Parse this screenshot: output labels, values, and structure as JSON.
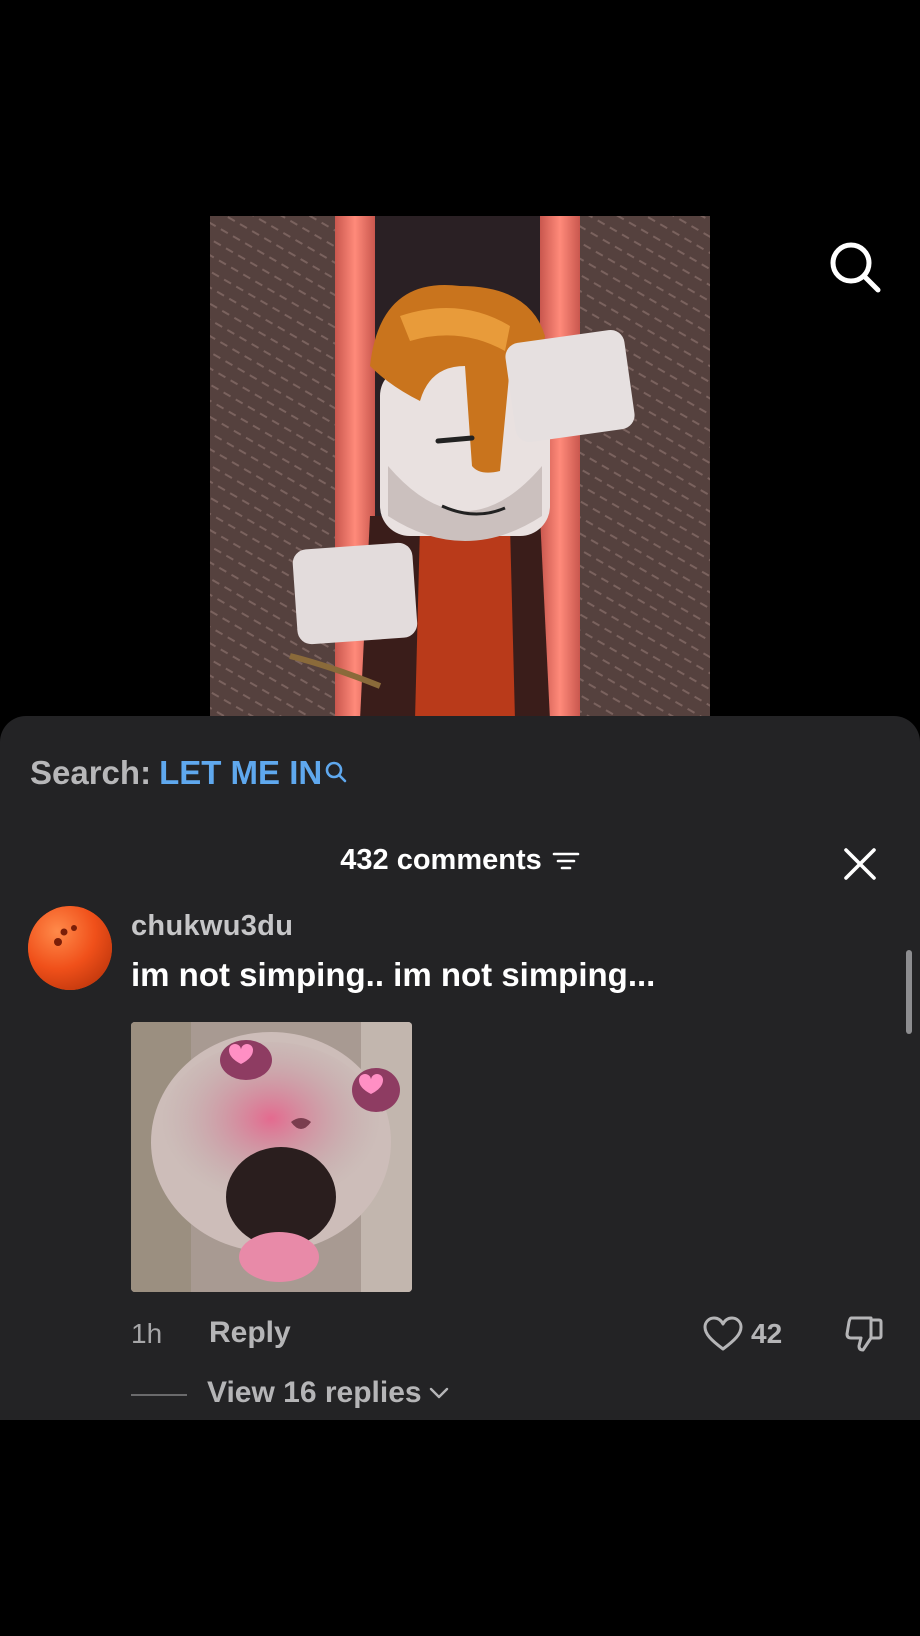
{
  "search": {
    "label": "Search:",
    "term": "LET ME IN"
  },
  "comments": {
    "count_label": "432 comments"
  },
  "comment": {
    "username": "chukwu3du",
    "text": "im not simping.. im not simping...",
    "timestamp": "1h",
    "reply_label": "Reply",
    "likes": "42",
    "view_replies_label": "View 16 replies"
  },
  "icons": {
    "top_search": "search-icon",
    "search_term": "search-icon",
    "sort": "filter-lines-icon",
    "close": "close-icon",
    "like": "heart-outline-icon",
    "dislike": "thumbs-down-icon",
    "chevron": "chevron-down-icon"
  },
  "colors": {
    "sheet_background": "#232325",
    "search_term": "#5fa8ee",
    "muted_text": "#b5b5b7"
  }
}
